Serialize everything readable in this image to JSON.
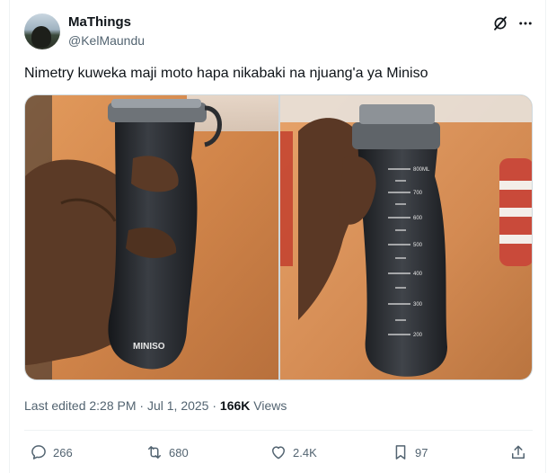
{
  "author": {
    "name": "MaThings",
    "handle": "@KelMaundu"
  },
  "header_icons": [
    "grok-icon",
    "more-icon"
  ],
  "tweet": {
    "text": "Nimetry kuweka maji moto hapa nikabaki na njuang'a ya Miniso"
  },
  "media": {
    "left_photo": {
      "bottle_label": "MINISO"
    },
    "right_photo": {
      "scale_marks": [
        "800ML",
        "700",
        "600",
        "500",
        "400",
        "300",
        "200"
      ]
    }
  },
  "meta": {
    "edited": "Last edited 2:28 PM · Jul 1, 2025 ·",
    "views_count": "166K",
    "views_label": "Views"
  },
  "actions": {
    "replies": "266",
    "reposts": "680",
    "likes": "2.4K",
    "bookmarks": "97"
  },
  "colors": {
    "text": "#0f1419",
    "secondary": "#536471",
    "border": "#eff3f4"
  }
}
